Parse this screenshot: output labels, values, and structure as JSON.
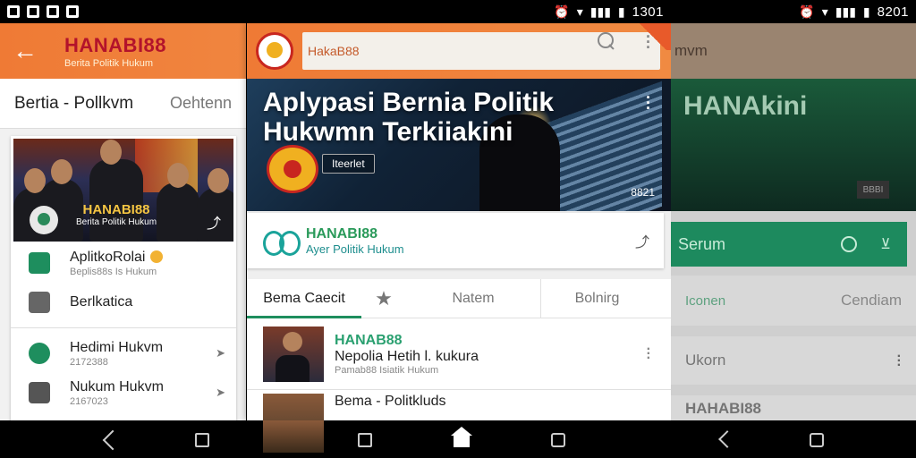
{
  "status_left": {
    "time": "1301"
  },
  "status_right": {
    "time": "8201"
  },
  "left_panel": {
    "brand_title": "HANABI88",
    "brand_subtitle": "Berita Politik Hukum",
    "section_title": "Bertia - Pollkvm",
    "section_action": "Oehtenn",
    "hero_brand": "HANABI88",
    "hero_subtitle": "Berita Politik Hukum",
    "list": [
      {
        "title": "AplitkoRolai",
        "subtitle": "Beplis88s Is Hukum",
        "icon": "bag-icon"
      },
      {
        "title": "Berlkatica",
        "subtitle": "",
        "icon": "doc-check-icon"
      },
      {
        "title": "Hedimi Hukvm",
        "subtitle": "2172388",
        "icon": "phone-icon"
      },
      {
        "title": "Nukum Hukvm",
        "subtitle": "2167023",
        "icon": "document-icon"
      }
    ]
  },
  "center_panel": {
    "search_text": "HakaB88",
    "hero_title": "Aplypasi Bernia Politik Hukwmn Terkiiakini",
    "hero_tag": "Iteerlet",
    "hero_count": "8821",
    "channel_name": "HANABI88",
    "channel_subtitle": "Ayer Politik Hukum",
    "tabs": [
      "Bema Caecit",
      "Natem",
      "Bolnirg"
    ],
    "feed": [
      {
        "brand": "HANAB88",
        "title": "Nepolia Hetih l. kukura",
        "meta": "Pamab88 Isiatik Hukum"
      },
      {
        "brand": "",
        "title": "Bema - Politkluds",
        "meta": ""
      }
    ]
  },
  "right_panel": {
    "header_text": "mvm",
    "hero_title": "HANAkini",
    "hero_button": "BBBI",
    "bar_text": "Serum",
    "row_a_left": "Iconen",
    "row_a_right": "Cendiam",
    "row_b_left": "Ukorn",
    "row_c_text": "HAHABI88"
  }
}
